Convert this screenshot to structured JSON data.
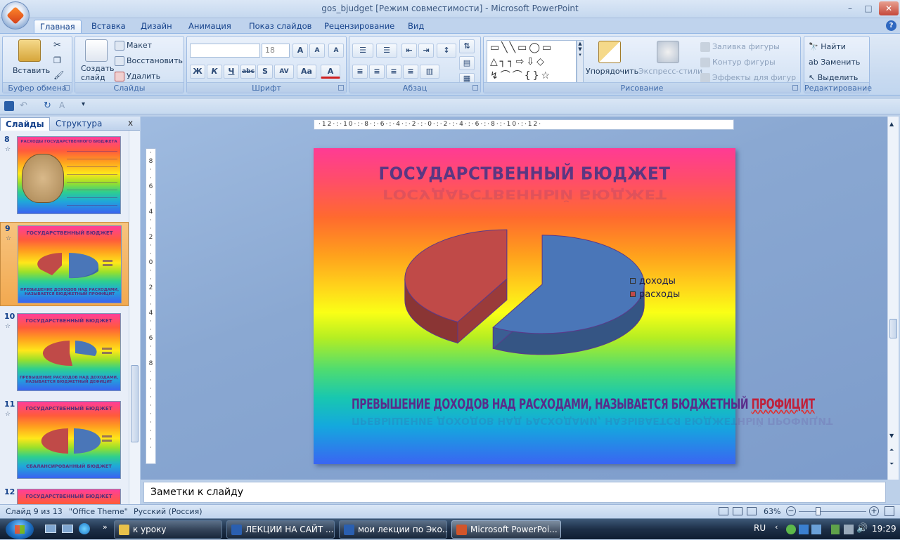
{
  "window": {
    "title": "gos_bjudget [Режим совместимости] - Microsoft PowerPoint",
    "buttons": {
      "minimize": "–",
      "maximize": "□",
      "close": "✕"
    }
  },
  "tabs": [
    "Главная",
    "Вставка",
    "Дизайн",
    "Анимация",
    "Показ слайдов",
    "Рецензирование",
    "Вид"
  ],
  "ribbon": {
    "clipboard": {
      "label": "Буфер обмена",
      "paste": "Вставить"
    },
    "slides": {
      "label": "Слайды",
      "new_slide": "Создать слайд",
      "layout": "Макет",
      "reset": "Восстановить",
      "delete": "Удалить"
    },
    "font": {
      "label": "Шрифт",
      "font_name": "",
      "font_size": "18",
      "bold": "Ж",
      "italic": "К",
      "underline": "Ч",
      "strike": "abc",
      "shadow": "S",
      "spacing": "AV",
      "case": "Aa",
      "color": "A"
    },
    "paragraph": {
      "label": "Абзац"
    },
    "drawing": {
      "label": "Рисование",
      "arrange": "Упорядочить",
      "quick_styles": "Экспресс-стили",
      "fill": "Заливка фигуры",
      "outline": "Контур фигуры",
      "effects": "Эффекты для фигур"
    },
    "editing": {
      "label": "Редактирование",
      "find": "Найти",
      "replace": "Заменить",
      "select": "Выделить"
    }
  },
  "left_pane": {
    "tabs": [
      "Слайды",
      "Структура"
    ],
    "close": "x",
    "thumbnails": [
      {
        "num": "8",
        "title": "РАСХОДЫ ГОСУДАРСТВЕННОГО БЮДЖЕТА",
        "footer": ""
      },
      {
        "num": "9",
        "title": "ГОСУДАРСТВЕННЫЙ БЮДЖЕТ",
        "footer": "ПРЕВЫШЕНИЕ ДОХОДОВ НАД РАСХОДАМИ, НАЗЫВАЕТСЯ БЮДЖЕТНЫЙ ПРОФИЦИТ"
      },
      {
        "num": "10",
        "title": "ГОСУДАРСТВЕННЫЙ БЮДЖЕТ",
        "footer": "ПРЕВЫШЕНИЕ РАСХОДОВ НАД ДОХОДАМИ, НАЗЫВАЕТСЯ БЮДЖЕТНЫЙ ДЕФИЦИТ"
      },
      {
        "num": "11",
        "title": "ГОСУДАРСТВЕННЫЙ БЮДЖЕТ",
        "footer": "СБАЛАНСИРОВАННЫЙ БЮДЖЕТ"
      },
      {
        "num": "12",
        "title": "ГОСУДАРСТВЕННЫЙ БЮДЖЕТ",
        "footer": ""
      }
    ]
  },
  "slide": {
    "title": "ГОСУДАРСТВЕННЫЙ БЮДЖЕТ",
    "footer_text": "ПРЕВЫШЕНИЕ ДОХОДОВ НАД РАСХОДАМИ, НАЗЫВАЕТСЯ БЮДЖЕТНЫЙ ",
    "footer_highlight": "ПРОФИЦИТ"
  },
  "chart_data": {
    "type": "pie",
    "categories": [
      "доходы",
      "расходы"
    ],
    "values": [
      58,
      42
    ],
    "colors": [
      "#4a76b8",
      "#c04a48"
    ],
    "legend_position": "right"
  },
  "notes": {
    "placeholder": "Заметки к слайду"
  },
  "status": {
    "slide": "Слайд 9 из 13",
    "theme": "\"Office Theme\"",
    "language": "Русский (Россия)",
    "zoom": "63%"
  },
  "taskbar": {
    "items": [
      {
        "label": "к уроку",
        "color": "#e8c14a"
      },
      {
        "label": "ЛЕКЦИИ НА САЙТ ...",
        "color": "#2a5fb0"
      },
      {
        "label": "мои лекции по Эко...",
        "color": "#2a5fb0"
      },
      {
        "label": "Microsoft PowerPoi...",
        "color": "#d2552a"
      }
    ],
    "lang": "RU",
    "time": "19:29"
  }
}
